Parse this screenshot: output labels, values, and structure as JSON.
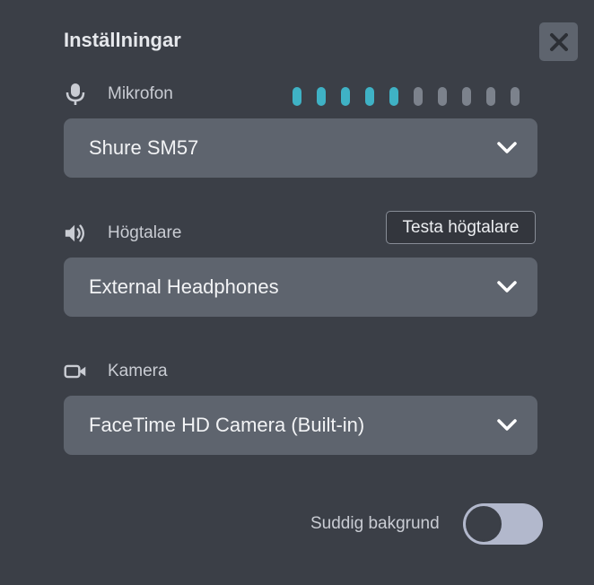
{
  "dialog": {
    "title": "Inställningar",
    "close_icon": "close-x-icon"
  },
  "microphone": {
    "label": "Mikrofon",
    "icon": "microphone-icon",
    "selected": "Shure SM57",
    "level": {
      "active": 5,
      "total": 10
    }
  },
  "speaker": {
    "label": "Högtalare",
    "icon": "speaker-icon",
    "test_label": "Testa högtalare",
    "selected": "External Headphones"
  },
  "camera": {
    "label": "Kamera",
    "icon": "video-camera-icon",
    "selected": "FaceTime HD Camera (Built-in)"
  },
  "blur": {
    "label": "Suddig bakgrund",
    "enabled": false
  },
  "colors": {
    "background": "#3b3f47",
    "field": "#5e646e",
    "meter_active": "#3fb2c5",
    "meter_inactive": "#7c828c",
    "toggle_track": "#b2b8cc"
  }
}
